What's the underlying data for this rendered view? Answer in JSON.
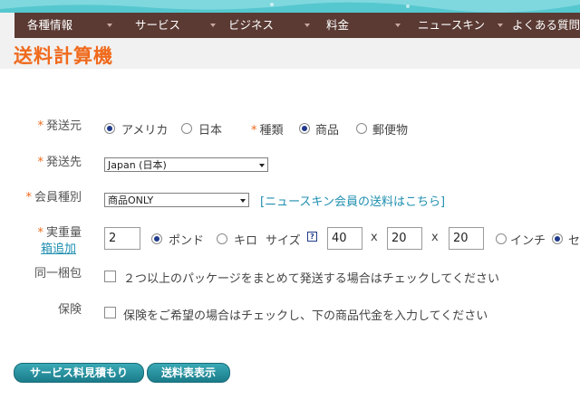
{
  "nav": {
    "items": [
      "各種情報",
      "サービス",
      "ビジネス",
      "料金",
      "ニュースキン",
      "よくある質問"
    ]
  },
  "page": {
    "title": "送料計算機"
  },
  "form": {
    "origin": {
      "label": "発送元",
      "options": [
        "アメリカ",
        "日本"
      ],
      "selected": "アメリカ"
    },
    "type": {
      "label": "種類",
      "options": [
        "商品",
        "郵便物"
      ],
      "selected": "商品"
    },
    "destination": {
      "label": "発送先",
      "value": "Japan (日本)"
    },
    "member": {
      "label": "会員種別",
      "value": "商品ONLY",
      "link": "[ニュースキン会員の送料はこちら]"
    },
    "weight": {
      "label": "実重量",
      "add_box": "箱追加",
      "value": "2",
      "units": [
        "ポンド",
        "キロ"
      ],
      "selected_unit": "ポンド"
    },
    "size": {
      "label": "サイズ",
      "help": "?",
      "dims": [
        "40",
        "20",
        "20"
      ],
      "x": "x",
      "units": [
        "インチ",
        "セ"
      ],
      "selected_unit": "セ"
    },
    "bundle": {
      "label": "同一梱包",
      "text": "２つ以上のパッケージをまとめて発送する場合はチェックしてください"
    },
    "insurance": {
      "label": "保険",
      "text": "保険をご希望の場合はチェックし、下の商品代金を入力してください"
    }
  },
  "buttons": {
    "estimate": "サービス料見積もり",
    "rate_table": "送料表表示"
  },
  "colors": {
    "accent": "#f06a1c",
    "nav_bg": "#5a3a33",
    "teal": "#55c7cf",
    "link": "#1f8fb0",
    "radio_on": "#1f3a8a"
  }
}
